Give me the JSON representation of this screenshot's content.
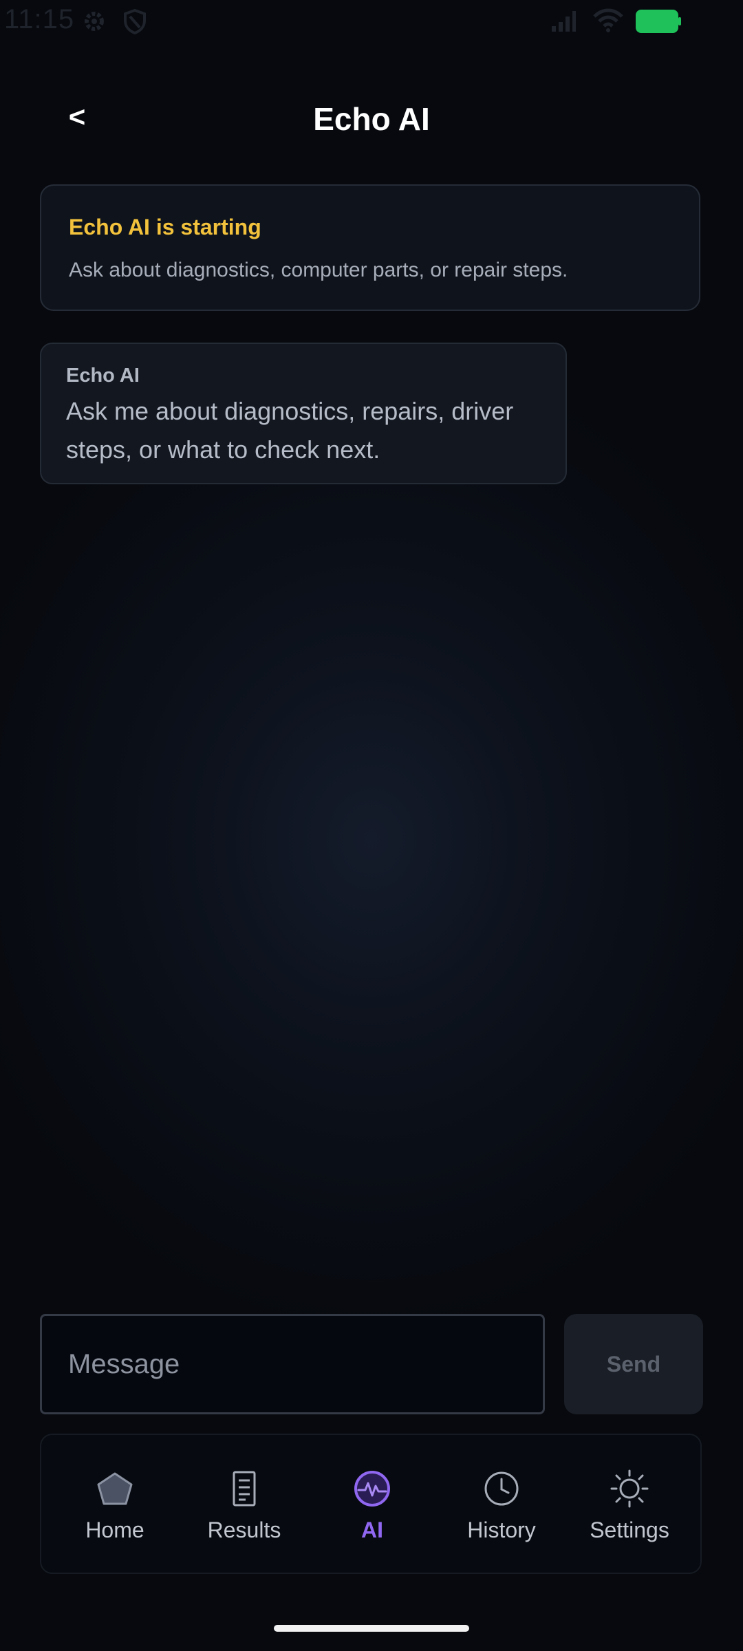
{
  "status_bar": {
    "time": "11:15",
    "icons": [
      "gear-icon",
      "shield-icon",
      "signal-icon",
      "wifi-icon",
      "battery-icon"
    ],
    "battery_color": "#1fc15a"
  },
  "header": {
    "back_label": "<",
    "title": "Echo AI"
  },
  "status_card": {
    "title": "Echo AI is starting",
    "text": "Ask about diagnostics, computer parts, or repair steps.",
    "title_color": "#f3c23c"
  },
  "messages": [
    {
      "sender": "Echo AI",
      "text": "Ask me about diagnostics, repairs, driver steps, or what to check next."
    }
  ],
  "composer": {
    "placeholder": "Message",
    "value": "",
    "send_label": "Send"
  },
  "nav": {
    "active": "AI",
    "accent_color": "#8f67f0",
    "items": [
      {
        "label": "Home",
        "icon": "pentagon-home-icon"
      },
      {
        "label": "Results",
        "icon": "document-icon"
      },
      {
        "label": "AI",
        "icon": "pulse-icon"
      },
      {
        "label": "History",
        "icon": "clock-icon"
      },
      {
        "label": "Settings",
        "icon": "sun-icon"
      }
    ]
  }
}
